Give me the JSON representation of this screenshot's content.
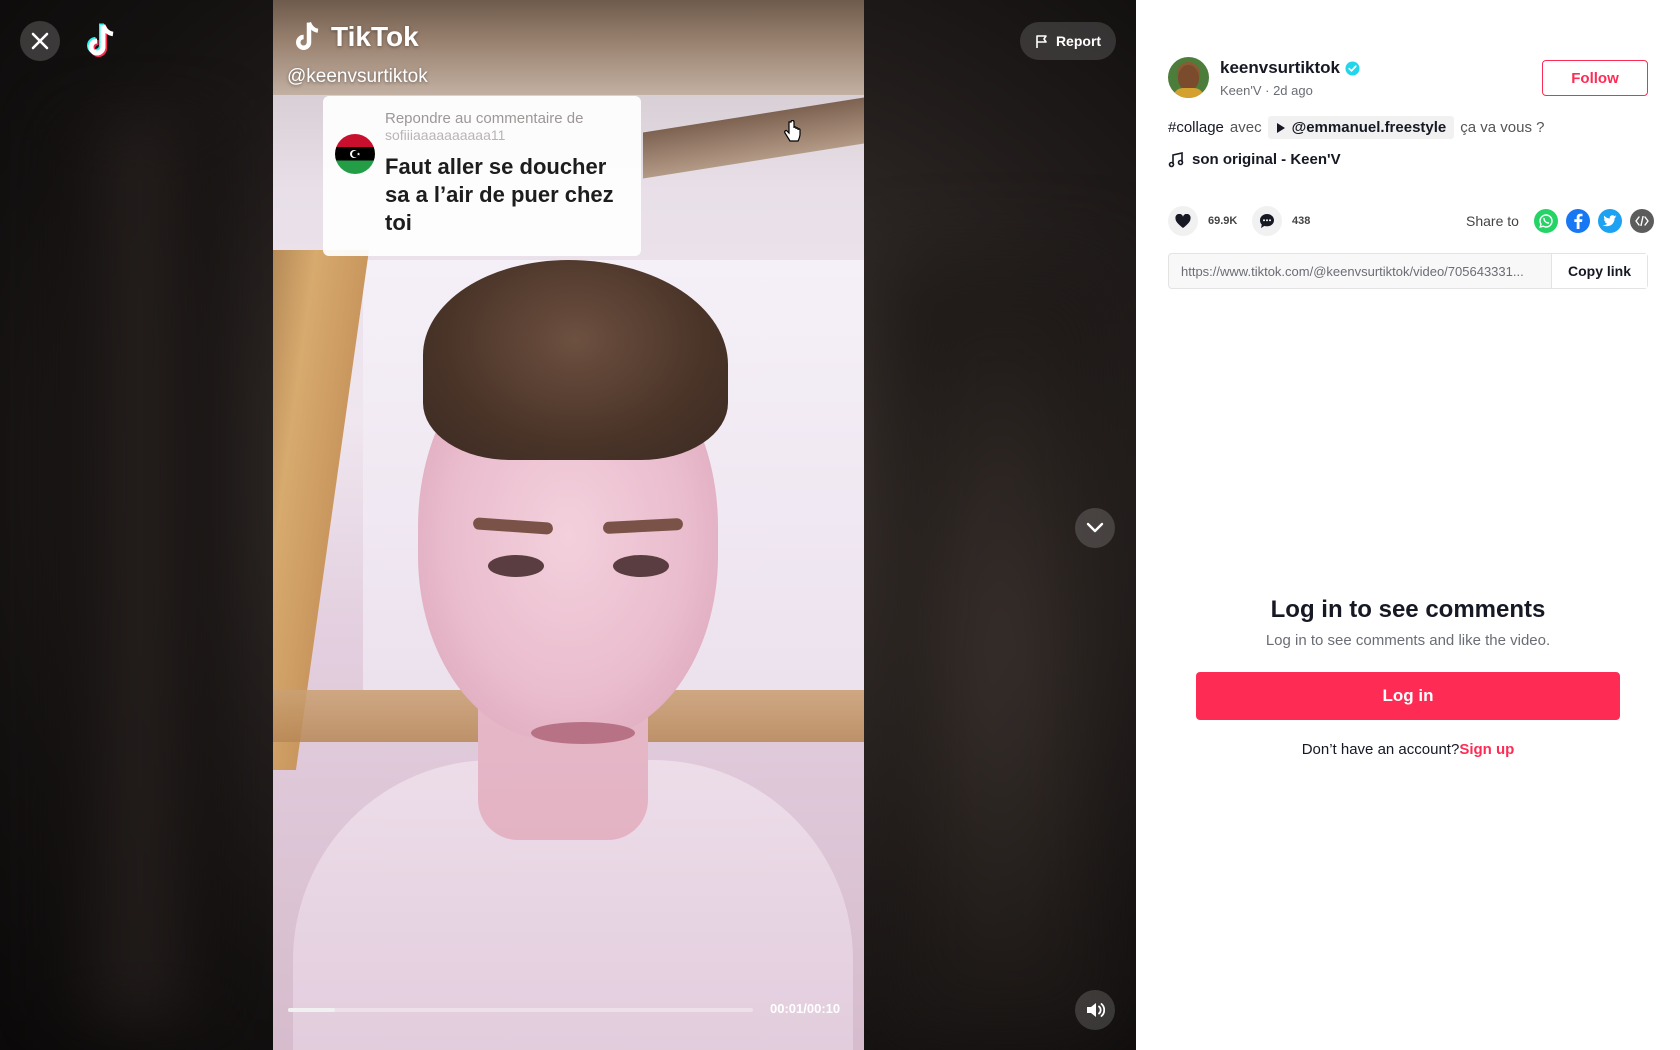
{
  "video": {
    "watermark_brand": "TikTok",
    "watermark_handle": "@keenvsurtiktok",
    "reply_card": {
      "label": "Repondre au commentaire de",
      "username": "sofiiiaaaaaaaaaa11",
      "text": "Faut aller se doucher sa a l’air de puer chez toi"
    },
    "time": "00:01/00:10",
    "progress_fraction": 0.1
  },
  "toolbar": {
    "report_label": "Report"
  },
  "author": {
    "username": "keenvsurtiktok",
    "meta": "Keen'V · 2d ago",
    "follow_label": "Follow"
  },
  "caption": {
    "hashtag": "#collage",
    "word": "avec",
    "mention": "@emmanuel.freestyle",
    "trailing": "ça va vous ?"
  },
  "music": {
    "title": "son original - Keen'V"
  },
  "stats": {
    "likes": "69.9K",
    "comments": "438",
    "share_label": "Share to"
  },
  "link": {
    "url": "https://www.tiktok.com/@keenvsurtiktok/video/705643331...",
    "copy_label": "Copy link"
  },
  "login": {
    "title": "Log in to see comments",
    "subtitle": "Log in to see comments and like the video.",
    "button": "Log in",
    "no_account": "Don’t have an account?",
    "signup": "Sign up"
  },
  "colors": {
    "accent": "#fe2c55",
    "whatsapp": "#25d366",
    "facebook": "#1877f2",
    "twitter": "#1da1f2",
    "embed": "#5c5c5c"
  },
  "icons": [
    "close-icon",
    "tiktok-logo-icon",
    "flag-icon",
    "chevron-down-icon",
    "volume-icon",
    "verified-badge-icon",
    "play-icon",
    "music-note-icon",
    "heart-icon",
    "comment-icon",
    "whatsapp-icon",
    "facebook-icon",
    "twitter-icon",
    "embed-icon",
    "cursor-icon"
  ]
}
